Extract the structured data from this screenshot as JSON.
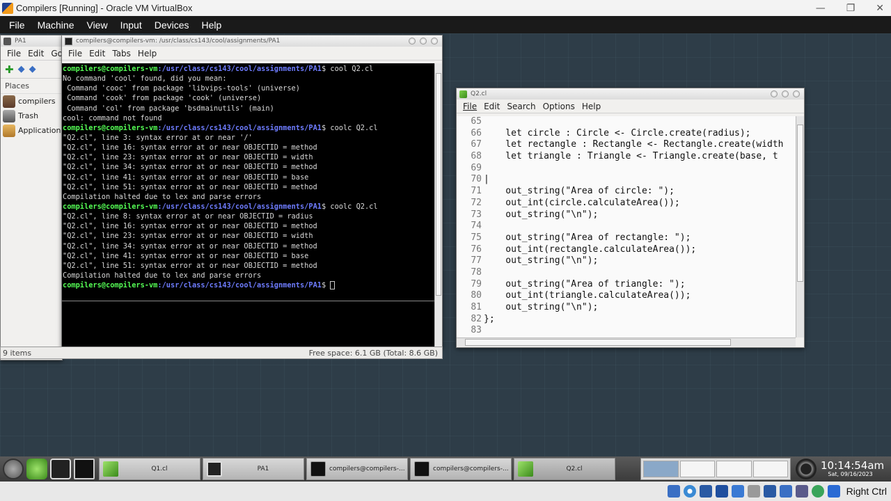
{
  "vbox": {
    "title": "Compilers [Running] - Oracle VM VirtualBox",
    "menu": [
      "File",
      "Machine",
      "View",
      "Input",
      "Devices",
      "Help"
    ],
    "window_controls": [
      "—",
      "❐",
      "✕"
    ],
    "host_key": "Right Ctrl"
  },
  "file_manager": {
    "title": "PA1",
    "menu": [
      "File",
      "Edit",
      "Go"
    ],
    "places_header": "Places",
    "places": [
      "compilers",
      "Trash",
      "Applications"
    ],
    "status_items": "9 items",
    "status_free": "Free space: 6.1 GB (Total: 8.6 GB)"
  },
  "terminal": {
    "title": "compilers@compilers-vm: /usr/class/cs143/cool/assignments/PA1",
    "menu": [
      "File",
      "Edit",
      "Tabs",
      "Help"
    ],
    "prompt_user": "compilers@compilers-vm",
    "prompt_path": ":/usr/class/cs143/cool/assignments/PA1",
    "lines": [
      {
        "prompt": true,
        "cmd": "$ cool Q2.cl"
      },
      {
        "text": "No command 'cool' found, did you mean:"
      },
      {
        "text": " Command 'cooc' from package 'libvips-tools' (universe)"
      },
      {
        "text": " Command 'cook' from package 'cook' (universe)"
      },
      {
        "text": " Command 'col' from package 'bsdmainutils' (main)"
      },
      {
        "text": "cool: command not found"
      },
      {
        "prompt": true,
        "cmd": "$ coolc Q2.cl"
      },
      {
        "text": "\"Q2.cl\", line 3: syntax error at or near '/'"
      },
      {
        "text": "\"Q2.cl\", line 16: syntax error at or near OBJECTID = method"
      },
      {
        "text": "\"Q2.cl\", line 23: syntax error at or near OBJECTID = width"
      },
      {
        "text": "\"Q2.cl\", line 34: syntax error at or near OBJECTID = method"
      },
      {
        "text": "\"Q2.cl\", line 41: syntax error at or near OBJECTID = base"
      },
      {
        "text": "\"Q2.cl\", line 51: syntax error at or near OBJECTID = method"
      },
      {
        "text": "Compilation halted due to lex and parse errors"
      },
      {
        "prompt": true,
        "cmd": "$ coolc Q2.cl"
      },
      {
        "text": "\"Q2.cl\", line 8: syntax error at or near OBJECTID = radius"
      },
      {
        "text": "\"Q2.cl\", line 16: syntax error at or near OBJECTID = method"
      },
      {
        "text": "\"Q2.cl\", line 23: syntax error at or near OBJECTID = width"
      },
      {
        "text": "\"Q2.cl\", line 34: syntax error at or near OBJECTID = method"
      },
      {
        "text": "\"Q2.cl\", line 41: syntax error at or near OBJECTID = base"
      },
      {
        "text": "\"Q2.cl\", line 51: syntax error at or near OBJECTID = method"
      },
      {
        "text": "Compilation halted due to lex and parse errors"
      },
      {
        "prompt": true,
        "cmd": "$ ",
        "cursor": true
      }
    ]
  },
  "editor": {
    "title": "Q2.cl",
    "menu": [
      "File",
      "Edit",
      "Search",
      "Options",
      "Help"
    ],
    "lines": [
      {
        "n": "65",
        "t": ""
      },
      {
        "n": "66",
        "t": "    let circle : Circle <- Circle.create(radius);"
      },
      {
        "n": "67",
        "t": "    let rectangle : Rectangle <- Rectangle.create(width"
      },
      {
        "n": "68",
        "t": "    let triangle : Triangle <- Triangle.create(base, t"
      },
      {
        "n": "69",
        "t": ""
      },
      {
        "n": "70",
        "t": "|"
      },
      {
        "n": "71",
        "t": "    out_string(\"Area of circle: \");"
      },
      {
        "n": "72",
        "t": "    out_int(circle.calculateArea());"
      },
      {
        "n": "73",
        "t": "    out_string(\"\\n\");"
      },
      {
        "n": "74",
        "t": ""
      },
      {
        "n": "75",
        "t": "    out_string(\"Area of rectangle: \");"
      },
      {
        "n": "76",
        "t": "    out_int(rectangle.calculateArea());"
      },
      {
        "n": "77",
        "t": "    out_string(\"\\n\");"
      },
      {
        "n": "78",
        "t": ""
      },
      {
        "n": "79",
        "t": "    out_string(\"Area of triangle: \");"
      },
      {
        "n": "80",
        "t": "    out_int(triangle.calculateArea());"
      },
      {
        "n": "81",
        "t": "    out_string(\"\\n\");"
      },
      {
        "n": "82",
        "t": "};"
      },
      {
        "n": "83",
        "t": ""
      }
    ]
  },
  "taskbar": {
    "tasks": [
      {
        "label": "Q1.cl"
      },
      {
        "label": "PA1"
      },
      {
        "label": "compilers@compilers-..."
      },
      {
        "label": "compilers@compilers-..."
      },
      {
        "label": "Q2.cl"
      }
    ],
    "clock_time": "10:14:54am",
    "clock_date": "Sat, 09/16/2023"
  },
  "colors": {
    "prompt_user": "#55ff55",
    "prompt_path": "#6e7cff",
    "desktop": "#2e3d48"
  }
}
